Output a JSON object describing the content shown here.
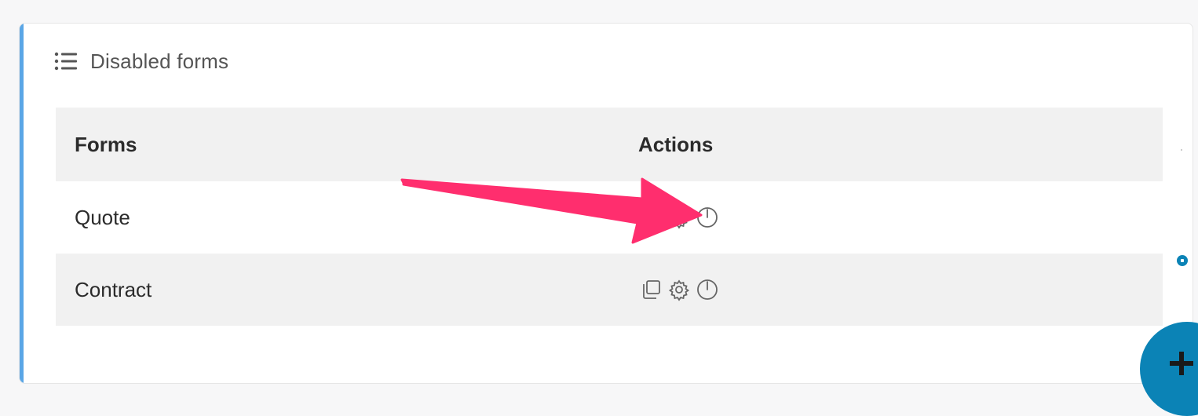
{
  "panel": {
    "title": "Disabled forms",
    "title_icon": "list-icon"
  },
  "table": {
    "headers": {
      "forms": "Forms",
      "actions": "Actions"
    },
    "rows": [
      {
        "name": "Quote",
        "actions": [
          "duplicate-icon",
          "settings-icon",
          "power-icon"
        ]
      },
      {
        "name": "Contract",
        "actions": [
          "duplicate-icon",
          "settings-icon",
          "power-icon"
        ]
      }
    ]
  },
  "annotation": {
    "type": "arrow",
    "color": "#ff2e6e",
    "points_to": "power-icon"
  },
  "fab": {
    "icon": "plus-icon",
    "color": "#0b83b6"
  },
  "colors": {
    "accent_border": "#5aa6e6",
    "header_bg": "#f1f1f1"
  }
}
